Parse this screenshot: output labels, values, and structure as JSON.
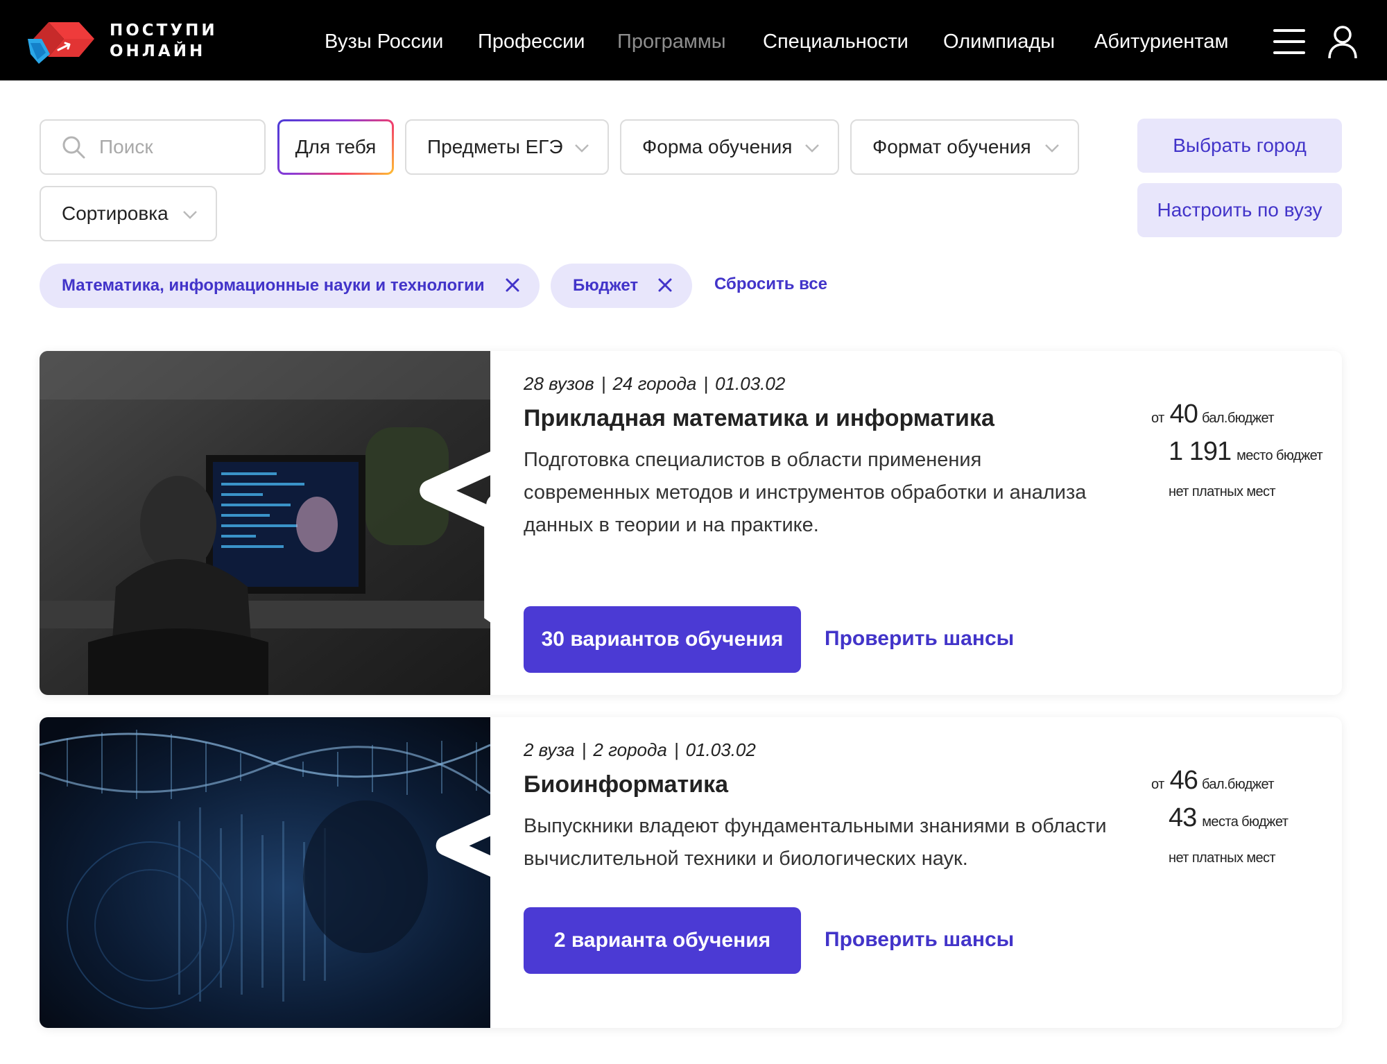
{
  "header": {
    "logo_line1": "ПОСТУПИ",
    "logo_line2": "ОНЛАЙН",
    "nav": [
      {
        "label": "Вузы России",
        "active": true
      },
      {
        "label": "Профессии",
        "active": true
      },
      {
        "label": "Программы",
        "active": false
      },
      {
        "label": "Специальности",
        "active": true
      },
      {
        "label": "Олимпиады",
        "active": true
      },
      {
        "label": "Абитуриентам",
        "active": true
      }
    ]
  },
  "filters": {
    "search_placeholder": "Поиск",
    "for_you": "Для тебя",
    "ege_subjects": "Предметы ЕГЭ",
    "study_form": "Форма обучения",
    "study_format": "Формат обучения",
    "sort": "Сортировка",
    "choose_city": "Выбрать город",
    "configure_by_university": "Настроить по вузу"
  },
  "active_filters": {
    "chips": [
      "Математика, информационные науки и технологии",
      "Бюджет"
    ],
    "reset_all": "Сбросить все"
  },
  "programs": [
    {
      "universities": "28 вузов",
      "cities": "24 города",
      "code": "01.03.02",
      "title": "Прикладная математика и информатика",
      "description": "Подготовка специалистов в области применения современных методов и инструментов обработки и анализа данных в теории и на практике.",
      "options_button": "30 вариантов обучения",
      "check_chances": "Проверить шансы",
      "score_prefix": "от",
      "score_value": "40",
      "score_label": "бал.бюджет",
      "places_value": "1 191",
      "places_label": "место бюджет",
      "paid_info": "нет платных мест"
    },
    {
      "universities": "2 вуза",
      "cities": "2 города",
      "code": "01.03.02",
      "title": "Биоинформатика",
      "description": "Выпускники владеют фундаментальными знаниями в области вычислительной техники и биологических наук.",
      "options_button": "2 варианта обучения",
      "check_chances": "Проверить шансы",
      "score_prefix": "от",
      "score_value": "46",
      "score_label": "бал.бюджет",
      "places_value": "43",
      "places_label": "места бюджет",
      "paid_info": "нет платных мест"
    }
  ],
  "icons": {
    "logo": "logo-mark-icon",
    "menu": "hamburger-icon",
    "profile": "user-icon",
    "search": "search-icon",
    "dropdown": "chevron-down-icon",
    "remove_chip": "close-icon",
    "university": "graduation-cap-icon",
    "favorite": "star-icon"
  },
  "colors": {
    "header_bg": "#000000",
    "accent": "#4b3ad4",
    "accent_light": "#e8e6fb",
    "logo_red": "#ef3b3b",
    "logo_blue": "#2aa7e8"
  }
}
